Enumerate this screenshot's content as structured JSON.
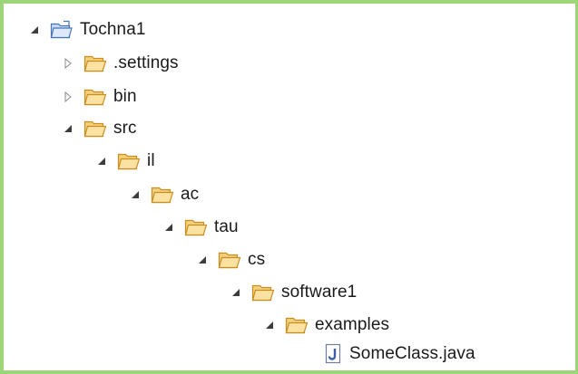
{
  "explorer": {
    "nodes": [
      {
        "label": "Tochna1",
        "icon": "project-folder-icon",
        "twisty": "expanded"
      },
      {
        "label": ".settings",
        "icon": "folder-icon",
        "twisty": "collapsed"
      },
      {
        "label": "bin",
        "icon": "folder-icon",
        "twisty": "collapsed"
      },
      {
        "label": "src",
        "icon": "folder-icon",
        "twisty": "expanded"
      },
      {
        "label": "il",
        "icon": "folder-icon",
        "twisty": "expanded"
      },
      {
        "label": "ac",
        "icon": "folder-icon",
        "twisty": "expanded"
      },
      {
        "label": "tau",
        "icon": "folder-icon",
        "twisty": "expanded"
      },
      {
        "label": "cs",
        "icon": "folder-icon",
        "twisty": "expanded"
      },
      {
        "label": "software1",
        "icon": "folder-icon",
        "twisty": "expanded"
      },
      {
        "label": "examples",
        "icon": "folder-icon",
        "twisty": "expanded"
      },
      {
        "label": "SomeClass.java",
        "icon": "java-file-icon",
        "twisty": "none"
      }
    ]
  },
  "colors": {
    "frame_border": "#9dd67a",
    "folder_fill": "#f5cf7a",
    "folder_stroke": "#c88e20",
    "project_folder_fill": "#c8dcf5",
    "project_folder_stroke": "#4a74b4",
    "java_icon": "#3b5ea8"
  }
}
